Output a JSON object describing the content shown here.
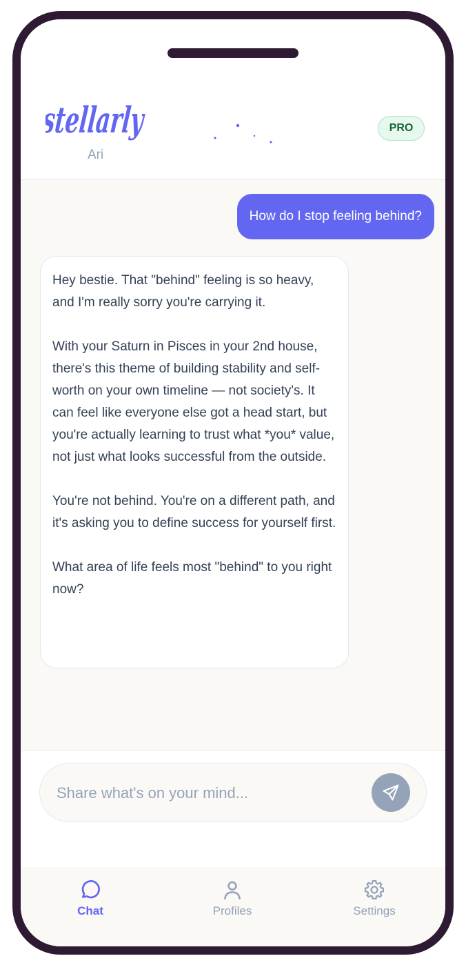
{
  "app": {
    "logo_text": "stellarly",
    "profile_name": "Ari",
    "badge": "PRO"
  },
  "colors": {
    "accent": "#6366f1",
    "frame": "#2f1a33",
    "badge_text": "#166534",
    "badge_bg": "#e7f8ef",
    "muted": "#94a3b8"
  },
  "chat": {
    "user_message": "How do I stop feeling behind?",
    "assistant_message": [
      "Hey bestie. That \"behind\" feeling is so heavy, and I'm really sorry you're carrying it.",
      "With your Saturn in Pisces in your 2nd house, there's this theme of building stability and self-worth on your own timeline — not society's. It can feel like everyone else got a head start, but you're actually learning to trust what *you* value, not just what looks successful from the outside.",
      "You're not behind. You're on a different path, and it's asking you to define success for yourself first.",
      "What area of life feels most \"behind\" to you right now?"
    ]
  },
  "composer": {
    "placeholder": "Share what's on your mind...",
    "value": "",
    "send_icon": "send-icon"
  },
  "tabs": [
    {
      "label": "Chat",
      "icon": "chat-bubble-icon",
      "active": true
    },
    {
      "label": "Profiles",
      "icon": "person-icon",
      "active": false
    },
    {
      "label": "Settings",
      "icon": "gear-icon",
      "active": false
    }
  ]
}
